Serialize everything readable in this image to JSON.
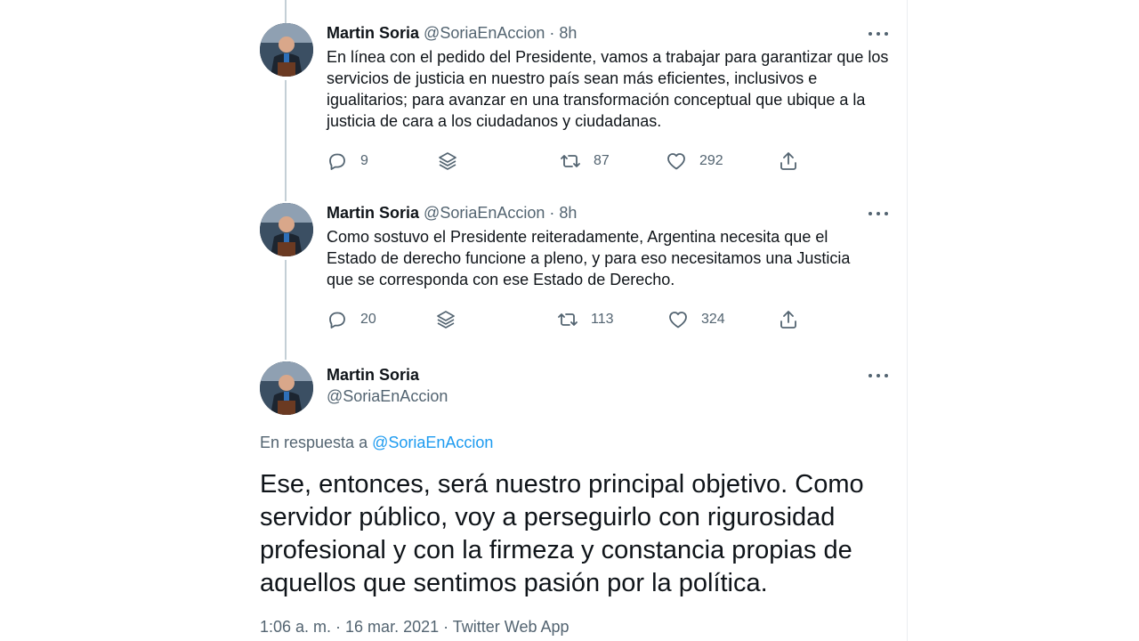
{
  "tweets": [
    {
      "name": "Martin Soria",
      "handle": "@SoriaEnAccion",
      "time": "8h",
      "text": "En línea con el pedido del Presidente, vamos a trabajar para garantizar que los servicios de justicia en nuestro país sean más eficientes, inclusivos e igualitarios; para avanzar en una transformación conceptual que ubique a la justicia de cara a los ciudadanos y ciudadanas.",
      "replies": "9",
      "retweets": "87",
      "likes": "292"
    },
    {
      "name": "Martin Soria",
      "handle": "@SoriaEnAccion",
      "time": "8h",
      "text": "Como sostuvo el Presidente reiteradamente, Argentina necesita que el Estado de derecho funcione a pleno, y para eso necesitamos una Justicia que se corresponda con ese Estado de Derecho.",
      "replies": "20",
      "retweets": "113",
      "likes": "324"
    }
  ],
  "main": {
    "name": "Martin Soria",
    "handle": "@SoriaEnAccion",
    "reply_prefix": "En respuesta a",
    "reply_handle": "@SoriaEnAccion",
    "text": "Ese, entonces, será nuestro principal objetivo. Como servidor público, voy a perseguirlo con rigurosidad profesional y con la firmeza y constancia propias de aquellos que sentimos pasión por la política.",
    "timestamp": "1:06 a. m. · 16 mar. 2021",
    "separator": " · ",
    "source": "Twitter Web App"
  },
  "icons": {
    "reply": "reply-icon",
    "stack": "layers-icon",
    "retweet": "retweet-icon",
    "like": "heart-icon",
    "share": "share-icon",
    "more": "more-icon"
  },
  "colors": {
    "text": "#0f1419",
    "secondary": "#536471",
    "link": "#1d9bf0",
    "thread_line": "#c4cfd6"
  }
}
